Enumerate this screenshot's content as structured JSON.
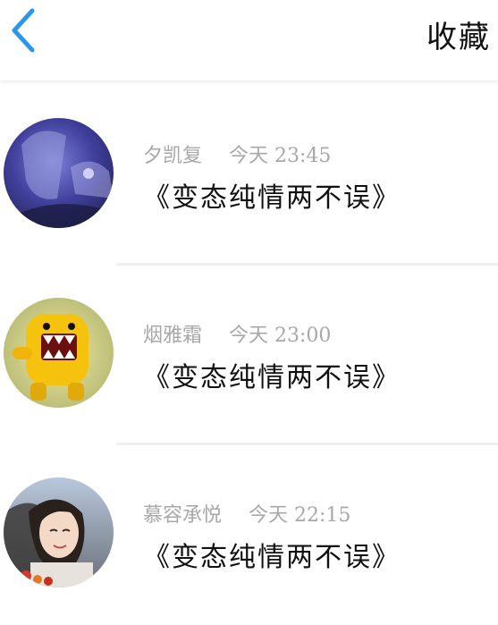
{
  "header": {
    "back_icon": "chevron-left-icon",
    "title": "收藏",
    "accent_color": "#2b95f0"
  },
  "favorites": [
    {
      "username": "夕凯复",
      "time": "今天 23:45",
      "title": "《变态纯情两不误》",
      "avatar": "avatar-anime-purple"
    },
    {
      "username": "烟雅霜",
      "time": "今天 23:00",
      "title": "《变态纯情两不误》",
      "avatar": "avatar-domo-yellow"
    },
    {
      "username": "慕容承悦",
      "time": "今天 22:15",
      "title": "《变态纯情两不误》",
      "avatar": "avatar-girl-photo"
    }
  ]
}
